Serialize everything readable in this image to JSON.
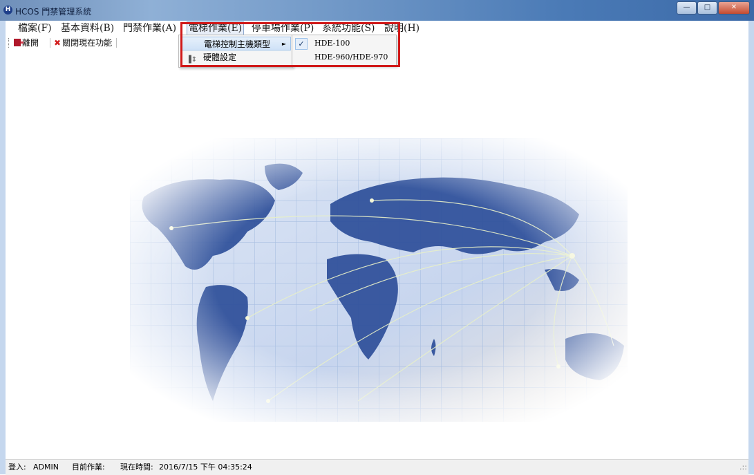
{
  "window": {
    "title": "HCOS 門禁管理系統",
    "app_icon_glyph": "H",
    "minimize_glyph": "—",
    "maximize_glyph": "□",
    "close_glyph": "✕"
  },
  "menubar": {
    "items": [
      {
        "label": "檔案(F)"
      },
      {
        "label": "基本資料(B)"
      },
      {
        "label": "門禁作業(A)"
      },
      {
        "label": "電梯作業(E)"
      },
      {
        "label": "停車場作業(P)"
      },
      {
        "label": "系統功能(S)"
      },
      {
        "label": "說明(H)"
      }
    ]
  },
  "toolbar": {
    "exit_label": "離開",
    "close_label": "關閉現在功能"
  },
  "dropdown": {
    "items": [
      {
        "label": "電梯控制主機類型",
        "arrow": "►"
      },
      {
        "label": "硬體設定",
        "icon_glyph": "▐⇕"
      }
    ]
  },
  "submenu": {
    "items": [
      {
        "label": "HDE-100",
        "checked": true,
        "check_glyph": "✓"
      },
      {
        "label": "HDE-960/HDE-970",
        "checked": false
      }
    ]
  },
  "statusbar": {
    "login_label": "登入:",
    "login_value": "ADMIN",
    "current_label": "目前作業:",
    "time_label": "現在時間:",
    "time_value": "2016/7/15 下午 04:35:24",
    "grip_glyph": ".::"
  },
  "colors": {
    "highlight_frame": "#d01818",
    "map_land": "#2e4f9a",
    "map_grid": "#9fb8de"
  }
}
